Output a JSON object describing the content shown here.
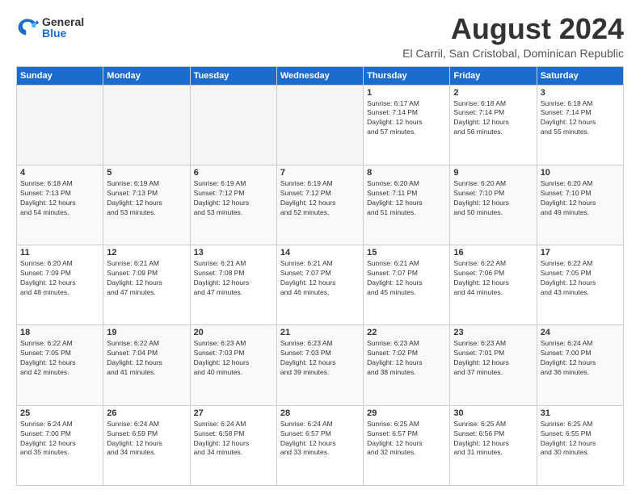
{
  "logo": {
    "general": "General",
    "blue": "Blue"
  },
  "title": {
    "month_year": "August 2024",
    "location": "El Carril, San Cristobal, Dominican Republic"
  },
  "days_of_week": [
    "Sunday",
    "Monday",
    "Tuesday",
    "Wednesday",
    "Thursday",
    "Friday",
    "Saturday"
  ],
  "weeks": [
    [
      {
        "day": "",
        "info": ""
      },
      {
        "day": "",
        "info": ""
      },
      {
        "day": "",
        "info": ""
      },
      {
        "day": "",
        "info": ""
      },
      {
        "day": "1",
        "info": "Sunrise: 6:17 AM\nSunset: 7:14 PM\nDaylight: 12 hours\nand 57 minutes."
      },
      {
        "day": "2",
        "info": "Sunrise: 6:18 AM\nSunset: 7:14 PM\nDaylight: 12 hours\nand 56 minutes."
      },
      {
        "day": "3",
        "info": "Sunrise: 6:18 AM\nSunset: 7:14 PM\nDaylight: 12 hours\nand 55 minutes."
      }
    ],
    [
      {
        "day": "4",
        "info": "Sunrise: 6:18 AM\nSunset: 7:13 PM\nDaylight: 12 hours\nand 54 minutes."
      },
      {
        "day": "5",
        "info": "Sunrise: 6:19 AM\nSunset: 7:13 PM\nDaylight: 12 hours\nand 53 minutes."
      },
      {
        "day": "6",
        "info": "Sunrise: 6:19 AM\nSunset: 7:12 PM\nDaylight: 12 hours\nand 53 minutes."
      },
      {
        "day": "7",
        "info": "Sunrise: 6:19 AM\nSunset: 7:12 PM\nDaylight: 12 hours\nand 52 minutes."
      },
      {
        "day": "8",
        "info": "Sunrise: 6:20 AM\nSunset: 7:11 PM\nDaylight: 12 hours\nand 51 minutes."
      },
      {
        "day": "9",
        "info": "Sunrise: 6:20 AM\nSunset: 7:10 PM\nDaylight: 12 hours\nand 50 minutes."
      },
      {
        "day": "10",
        "info": "Sunrise: 6:20 AM\nSunset: 7:10 PM\nDaylight: 12 hours\nand 49 minutes."
      }
    ],
    [
      {
        "day": "11",
        "info": "Sunrise: 6:20 AM\nSunset: 7:09 PM\nDaylight: 12 hours\nand 48 minutes."
      },
      {
        "day": "12",
        "info": "Sunrise: 6:21 AM\nSunset: 7:09 PM\nDaylight: 12 hours\nand 47 minutes."
      },
      {
        "day": "13",
        "info": "Sunrise: 6:21 AM\nSunset: 7:08 PM\nDaylight: 12 hours\nand 47 minutes."
      },
      {
        "day": "14",
        "info": "Sunrise: 6:21 AM\nSunset: 7:07 PM\nDaylight: 12 hours\nand 46 minutes."
      },
      {
        "day": "15",
        "info": "Sunrise: 6:21 AM\nSunset: 7:07 PM\nDaylight: 12 hours\nand 45 minutes."
      },
      {
        "day": "16",
        "info": "Sunrise: 6:22 AM\nSunset: 7:06 PM\nDaylight: 12 hours\nand 44 minutes."
      },
      {
        "day": "17",
        "info": "Sunrise: 6:22 AM\nSunset: 7:05 PM\nDaylight: 12 hours\nand 43 minutes."
      }
    ],
    [
      {
        "day": "18",
        "info": "Sunrise: 6:22 AM\nSunset: 7:05 PM\nDaylight: 12 hours\nand 42 minutes."
      },
      {
        "day": "19",
        "info": "Sunrise: 6:22 AM\nSunset: 7:04 PM\nDaylight: 12 hours\nand 41 minutes."
      },
      {
        "day": "20",
        "info": "Sunrise: 6:23 AM\nSunset: 7:03 PM\nDaylight: 12 hours\nand 40 minutes."
      },
      {
        "day": "21",
        "info": "Sunrise: 6:23 AM\nSunset: 7:03 PM\nDaylight: 12 hours\nand 39 minutes."
      },
      {
        "day": "22",
        "info": "Sunrise: 6:23 AM\nSunset: 7:02 PM\nDaylight: 12 hours\nand 38 minutes."
      },
      {
        "day": "23",
        "info": "Sunrise: 6:23 AM\nSunset: 7:01 PM\nDaylight: 12 hours\nand 37 minutes."
      },
      {
        "day": "24",
        "info": "Sunrise: 6:24 AM\nSunset: 7:00 PM\nDaylight: 12 hours\nand 36 minutes."
      }
    ],
    [
      {
        "day": "25",
        "info": "Sunrise: 6:24 AM\nSunset: 7:00 PM\nDaylight: 12 hours\nand 35 minutes."
      },
      {
        "day": "26",
        "info": "Sunrise: 6:24 AM\nSunset: 6:59 PM\nDaylight: 12 hours\nand 34 minutes."
      },
      {
        "day": "27",
        "info": "Sunrise: 6:24 AM\nSunset: 6:58 PM\nDaylight: 12 hours\nand 34 minutes."
      },
      {
        "day": "28",
        "info": "Sunrise: 6:24 AM\nSunset: 6:57 PM\nDaylight: 12 hours\nand 33 minutes."
      },
      {
        "day": "29",
        "info": "Sunrise: 6:25 AM\nSunset: 6:57 PM\nDaylight: 12 hours\nand 32 minutes."
      },
      {
        "day": "30",
        "info": "Sunrise: 6:25 AM\nSunset: 6:56 PM\nDaylight: 12 hours\nand 31 minutes."
      },
      {
        "day": "31",
        "info": "Sunrise: 6:25 AM\nSunset: 6:55 PM\nDaylight: 12 hours\nand 30 minutes."
      }
    ]
  ]
}
